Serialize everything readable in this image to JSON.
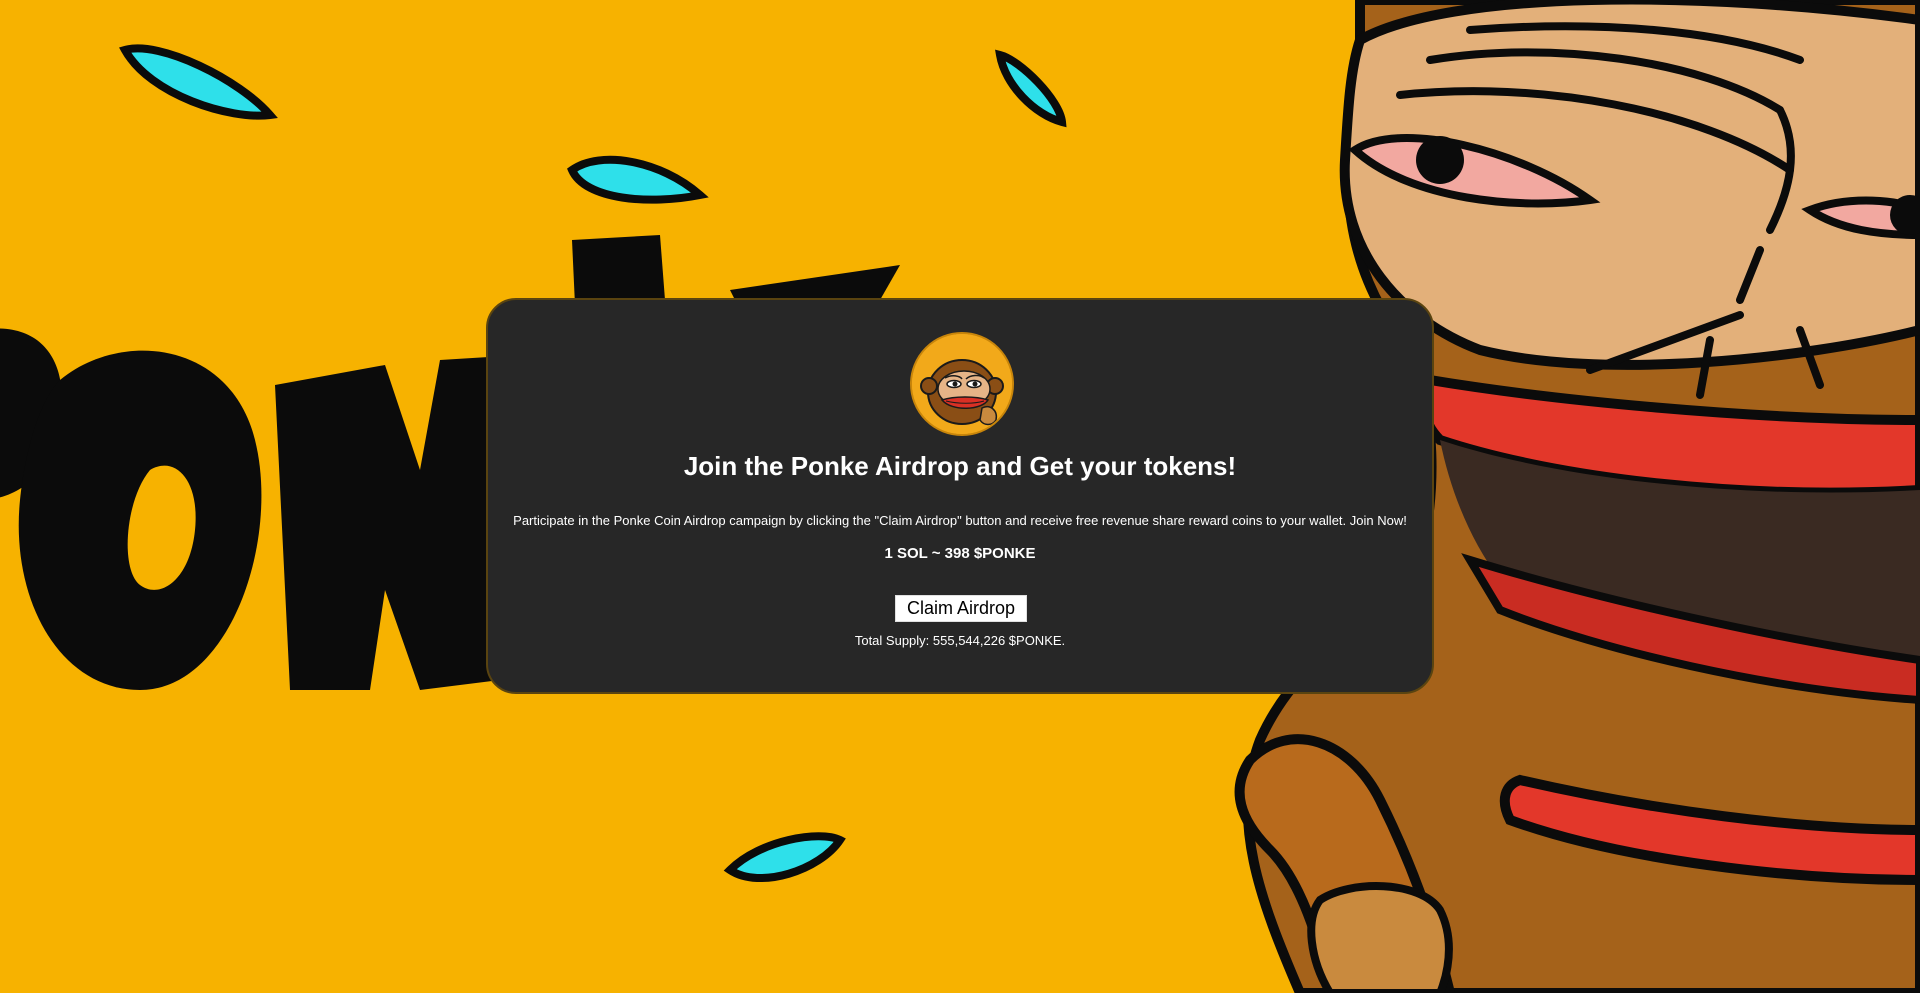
{
  "colors": {
    "background": "#f7b200",
    "card": "#272727",
    "text": "#ffffff",
    "button_bg": "#ffffff",
    "button_text": "#000000",
    "droplet": "#2ee0ea"
  },
  "card": {
    "logo_icon": "ponke-monkey-logo",
    "title": "Join the Ponke Airdrop and Get your tokens!",
    "description": "Participate in the Ponke Coin Airdrop campaign by clicking the \"Claim Airdrop\" button and receive free revenue share reward coins to your wallet. Join Now!",
    "rate": "1 SOL ~ 398 $PONKE",
    "claim_label": "Claim Airdrop",
    "supply": "Total Supply: 555,544,226 $PONKE."
  },
  "background": {
    "icon": "ponke-monkey-artwork"
  }
}
